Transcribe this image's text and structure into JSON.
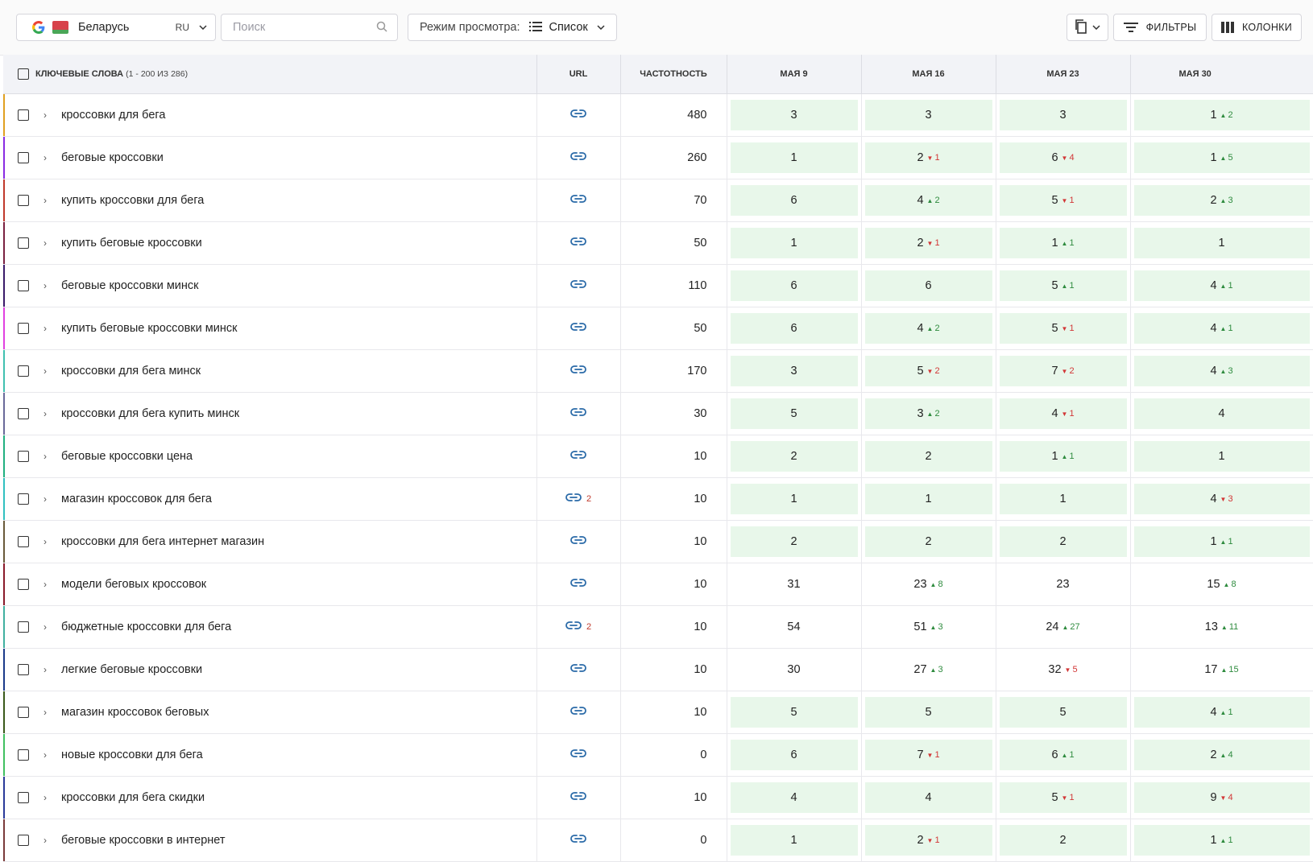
{
  "toolbar": {
    "region": {
      "name": "Беларусь",
      "lang": "RU"
    },
    "search": {
      "placeholder": "Поиск",
      "value": ""
    },
    "view_mode": {
      "label": "Режим просмотра:",
      "value": "Список"
    },
    "filters_label": "ФИЛЬТРЫ",
    "columns_label": "КОЛОНКИ"
  },
  "table": {
    "headers": {
      "keywords": "КЛЮЧЕВЫЕ СЛОВА",
      "keywords_count": "(1 - 200 ИЗ 286)",
      "url": "URL",
      "frequency": "ЧАСТОТНОСТЬ",
      "dates": [
        "МАЯ 9",
        "МАЯ 16",
        "МАЯ 23",
        "МАЯ 30"
      ]
    },
    "rows": [
      {
        "kw": "кроссовки для бега",
        "color": "#e0a020",
        "url_count": "",
        "freq": "480",
        "pos": [
          {
            "v": "3",
            "c": "",
            "d": "",
            "top": true
          },
          {
            "v": "3",
            "c": "",
            "d": "",
            "top": true
          },
          {
            "v": "3",
            "c": "",
            "d": "",
            "top": true
          },
          {
            "v": "1",
            "c": "2",
            "d": "up",
            "top": true
          }
        ]
      },
      {
        "kw": "беговые кроссовки",
        "color": "#8a2be2",
        "url_count": "",
        "freq": "260",
        "pos": [
          {
            "v": "1",
            "c": "",
            "d": "",
            "top": true
          },
          {
            "v": "2",
            "c": "1",
            "d": "down",
            "top": true
          },
          {
            "v": "6",
            "c": "4",
            "d": "down",
            "top": true
          },
          {
            "v": "1",
            "c": "5",
            "d": "up",
            "top": true
          }
        ]
      },
      {
        "kw": "купить кроссовки для бега",
        "color": "#c0392b",
        "url_count": "",
        "freq": "70",
        "pos": [
          {
            "v": "6",
            "c": "",
            "d": "",
            "top": true
          },
          {
            "v": "4",
            "c": "2",
            "d": "up",
            "top": true
          },
          {
            "v": "5",
            "c": "1",
            "d": "down",
            "top": true
          },
          {
            "v": "2",
            "c": "3",
            "d": "up",
            "top": true
          }
        ]
      },
      {
        "kw": "купить беговые кроссовки",
        "color": "#7a2040",
        "url_count": "",
        "freq": "50",
        "pos": [
          {
            "v": "1",
            "c": "",
            "d": "",
            "top": true
          },
          {
            "v": "2",
            "c": "1",
            "d": "down",
            "top": true
          },
          {
            "v": "1",
            "c": "1",
            "d": "up",
            "top": true
          },
          {
            "v": "1",
            "c": "",
            "d": "",
            "top": true
          }
        ]
      },
      {
        "kw": "беговые кроссовки минск",
        "color": "#3a1a6a",
        "url_count": "",
        "freq": "110",
        "pos": [
          {
            "v": "6",
            "c": "",
            "d": "",
            "top": true
          },
          {
            "v": "6",
            "c": "",
            "d": "",
            "top": true
          },
          {
            "v": "5",
            "c": "1",
            "d": "up",
            "top": true
          },
          {
            "v": "4",
            "c": "1",
            "d": "up",
            "top": true
          }
        ]
      },
      {
        "kw": "купить беговые кроссовки минск",
        "color": "#e040e0",
        "url_count": "",
        "freq": "50",
        "pos": [
          {
            "v": "6",
            "c": "",
            "d": "",
            "top": true
          },
          {
            "v": "4",
            "c": "2",
            "d": "up",
            "top": true
          },
          {
            "v": "5",
            "c": "1",
            "d": "down",
            "top": true
          },
          {
            "v": "4",
            "c": "1",
            "d": "up",
            "top": true
          }
        ]
      },
      {
        "kw": "кроссовки для бега минск",
        "color": "#40c0b0",
        "url_count": "",
        "freq": "170",
        "pos": [
          {
            "v": "3",
            "c": "",
            "d": "",
            "top": true
          },
          {
            "v": "5",
            "c": "2",
            "d": "down",
            "top": true
          },
          {
            "v": "7",
            "c": "2",
            "d": "down",
            "top": true
          },
          {
            "v": "4",
            "c": "3",
            "d": "up",
            "top": true
          }
        ]
      },
      {
        "kw": "кроссовки для бега купить минск",
        "color": "#6a6a9a",
        "url_count": "",
        "freq": "30",
        "pos": [
          {
            "v": "5",
            "c": "",
            "d": "",
            "top": true
          },
          {
            "v": "3",
            "c": "2",
            "d": "up",
            "top": true
          },
          {
            "v": "4",
            "c": "1",
            "d": "down",
            "top": true
          },
          {
            "v": "4",
            "c": "",
            "d": "",
            "top": true
          }
        ]
      },
      {
        "kw": "беговые кроссовки цена",
        "color": "#20b080",
        "url_count": "",
        "freq": "10",
        "pos": [
          {
            "v": "2",
            "c": "",
            "d": "",
            "top": true
          },
          {
            "v": "2",
            "c": "",
            "d": "",
            "top": true
          },
          {
            "v": "1",
            "c": "1",
            "d": "up",
            "top": true
          },
          {
            "v": "1",
            "c": "",
            "d": "",
            "top": true
          }
        ]
      },
      {
        "kw": "магазин кроссовок для бега",
        "color": "#30c0c0",
        "url_count": "2",
        "freq": "10",
        "pos": [
          {
            "v": "1",
            "c": "",
            "d": "",
            "top": true
          },
          {
            "v": "1",
            "c": "",
            "d": "",
            "top": true
          },
          {
            "v": "1",
            "c": "",
            "d": "",
            "top": true
          },
          {
            "v": "4",
            "c": "3",
            "d": "down",
            "top": true
          }
        ]
      },
      {
        "kw": "кроссовки для бега интернет магазин",
        "color": "#6a5a3a",
        "url_count": "",
        "freq": "10",
        "pos": [
          {
            "v": "2",
            "c": "",
            "d": "",
            "top": true
          },
          {
            "v": "2",
            "c": "",
            "d": "",
            "top": true
          },
          {
            "v": "2",
            "c": "",
            "d": "",
            "top": true
          },
          {
            "v": "1",
            "c": "1",
            "d": "up",
            "top": true
          }
        ]
      },
      {
        "kw": "модели беговых кроссовок",
        "color": "#8a1a2a",
        "url_count": "",
        "freq": "10",
        "pos": [
          {
            "v": "31",
            "c": "",
            "d": "",
            "top": false
          },
          {
            "v": "23",
            "c": "8",
            "d": "up",
            "top": false
          },
          {
            "v": "23",
            "c": "",
            "d": "",
            "top": false
          },
          {
            "v": "15",
            "c": "8",
            "d": "up",
            "top": false
          }
        ]
      },
      {
        "kw": "бюджетные кроссовки для бега",
        "color": "#40b0a0",
        "url_count": "2",
        "freq": "10",
        "pos": [
          {
            "v": "54",
            "c": "",
            "d": "",
            "top": false
          },
          {
            "v": "51",
            "c": "3",
            "d": "up",
            "top": false
          },
          {
            "v": "24",
            "c": "27",
            "d": "up",
            "top": false
          },
          {
            "v": "13",
            "c": "11",
            "d": "up",
            "top": false
          }
        ]
      },
      {
        "kw": "легкие беговые кроссовки",
        "color": "#1a3a8a",
        "url_count": "",
        "freq": "10",
        "pos": [
          {
            "v": "30",
            "c": "",
            "d": "",
            "top": false
          },
          {
            "v": "27",
            "c": "3",
            "d": "up",
            "top": false
          },
          {
            "v": "32",
            "c": "5",
            "d": "down",
            "top": false
          },
          {
            "v": "17",
            "c": "15",
            "d": "up",
            "top": false
          }
        ]
      },
      {
        "kw": "магазин кроссовок беговых",
        "color": "#3a5a1a",
        "url_count": "",
        "freq": "10",
        "pos": [
          {
            "v": "5",
            "c": "",
            "d": "",
            "top": true
          },
          {
            "v": "5",
            "c": "",
            "d": "",
            "top": true
          },
          {
            "v": "5",
            "c": "",
            "d": "",
            "top": true
          },
          {
            "v": "4",
            "c": "1",
            "d": "up",
            "top": true
          }
        ]
      },
      {
        "kw": "новые кроссовки для бега",
        "color": "#40c060",
        "url_count": "",
        "freq": "0",
        "pos": [
          {
            "v": "6",
            "c": "",
            "d": "",
            "top": true
          },
          {
            "v": "7",
            "c": "1",
            "d": "down",
            "top": true
          },
          {
            "v": "6",
            "c": "1",
            "d": "up",
            "top": true
          },
          {
            "v": "2",
            "c": "4",
            "d": "up",
            "top": true
          }
        ]
      },
      {
        "kw": "кроссовки для бега скидки",
        "color": "#2a3a9a",
        "url_count": "",
        "freq": "10",
        "pos": [
          {
            "v": "4",
            "c": "",
            "d": "",
            "top": true
          },
          {
            "v": "4",
            "c": "",
            "d": "",
            "top": true
          },
          {
            "v": "5",
            "c": "1",
            "d": "down",
            "top": true
          },
          {
            "v": "9",
            "c": "4",
            "d": "down",
            "top": true
          }
        ]
      },
      {
        "kw": "беговые кроссовки в интернет",
        "color": "#7a3a3a",
        "url_count": "",
        "freq": "0",
        "pos": [
          {
            "v": "1",
            "c": "",
            "d": "",
            "top": true
          },
          {
            "v": "2",
            "c": "1",
            "d": "down",
            "top": true
          },
          {
            "v": "2",
            "c": "",
            "d": "",
            "top": true
          },
          {
            "v": "1",
            "c": "1",
            "d": "up",
            "top": true
          }
        ]
      }
    ]
  }
}
